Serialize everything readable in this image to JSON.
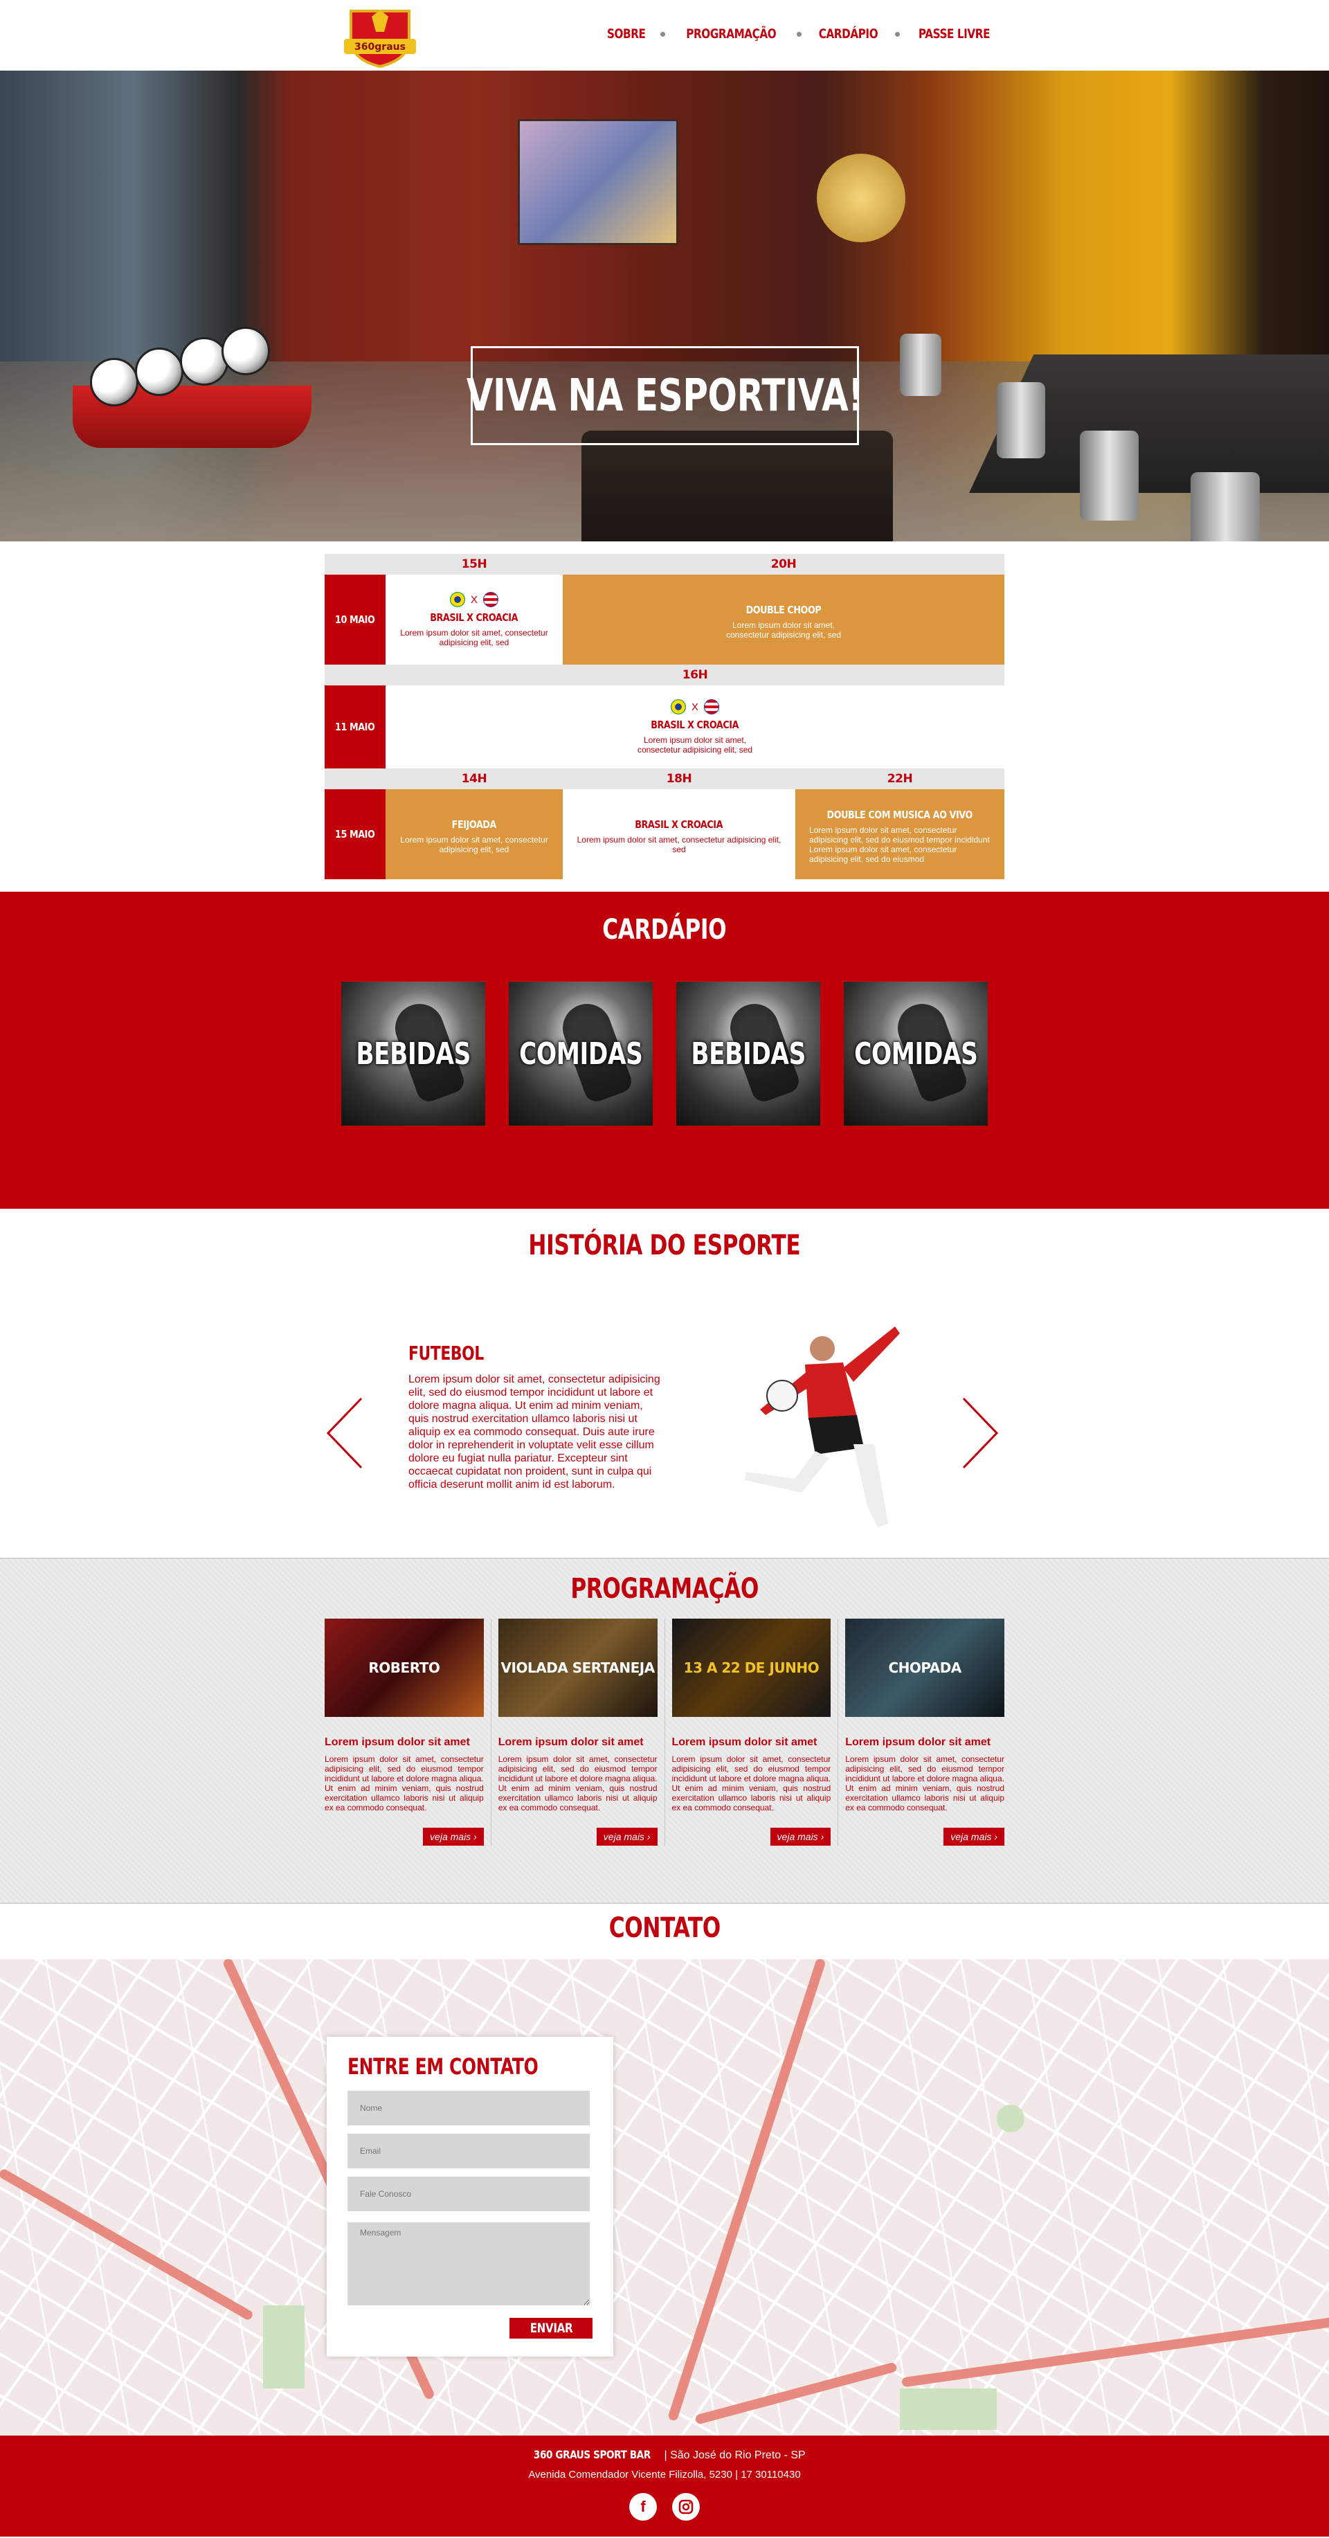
{
  "nav": {
    "items": [
      "SOBRE",
      "PROGRAMAÇÃO",
      "CARDÁPIO",
      "PASSE LIVRE"
    ]
  },
  "logo": {
    "text": "360graus"
  },
  "hero": {
    "title": "VIVA NA ESPORTIVA!"
  },
  "schedule": {
    "rows": [
      {
        "times": [
          "15H",
          "20H"
        ],
        "day": "10 MAIO",
        "cells": [
          {
            "title": "BRASIL X CROACIA",
            "text": "Lorem ipsum dolor sit amet, consectetur adipisicing elit, sed",
            "vs": "X"
          },
          {
            "title": "DOUBLE CHOOP",
            "text": "Lorem ipsum dolor sit amet, consectetur adipisicing elit, sed"
          }
        ]
      },
      {
        "times": [
          "16H"
        ],
        "day": "11 MAIO",
        "cells": [
          {
            "title": "BRASIL X CROACIA",
            "text": "Lorem ipsum dolor sit amet, consectetur adipisicing elit, sed",
            "vs": "X"
          }
        ]
      },
      {
        "times": [
          "14H",
          "18H",
          "22H"
        ],
        "day": "15 MAIO",
        "cells": [
          {
            "title": "FEIJOADA",
            "text": "Lorem ipsum dolor sit amet, consectetur adipisicing elit, sed"
          },
          {
            "title": "BRASIL X CROACIA",
            "text": "Lorem ipsum dolor sit amet, consectetur adipisicing elit, sed"
          },
          {
            "title": "DOUBLE COM MUSICA AO VIVO",
            "text": "Lorem ipsum dolor sit amet, consectetur adipisicing elit, sed do eiusmod tempor incididunt Lorem ipsum dolor sit amet, consectetur adipisicing elit, sed do eiusmod"
          }
        ]
      }
    ]
  },
  "cardapio": {
    "title": "CARDÁPIO",
    "items": [
      "BEBIDAS",
      "COMIDAS",
      "BEBIDAS",
      "COMIDAS"
    ]
  },
  "historia": {
    "title": "HISTÓRIA DO ESPORTE",
    "subtitle": "FUTEBOL",
    "text": "Lorem ipsum dolor sit amet, consectetur adipisicing elit, sed do eiusmod tempor incididunt ut labore et dolore magna aliqua. Ut enim ad minim veniam, quis nostrud exercitation ullamco laboris nisi ut aliquip ex ea commodo consequat. Duis aute irure dolor in reprehenderit in voluptate velit esse cillum dolore eu fugiat nulla pariatur. Excepteur sint occaecat cupidatat non proident, sunt in culpa qui officia deserunt mollit anim id est laborum."
  },
  "programacao": {
    "title": "PROGRAMAÇÃO",
    "button": "veja mais",
    "cards": [
      {
        "poster": "ROBERTO",
        "heading": "Lorem ipsum dolor sit amet",
        "text": "Lorem ipsum dolor sit amet, consectetur adipisicing elit, sed do eiusmod tempor incididunt ut labore et dolore magna aliqua. Ut enim ad minim veniam, quis nostrud exercitation ullamco laboris nisi ut aliquip ex ea commodo consequat.",
        "bg": "#7a1212"
      },
      {
        "poster": "VIOLADA SERTANEJA",
        "heading": "Lorem ipsum dolor sit amet",
        "text": "Lorem ipsum dolor sit amet, consectetur adipisicing elit, sed do eiusmod tempor incididunt ut labore et dolore magna aliqua. Ut enim ad minim veniam, quis nostrud exercitation ullamco laboris nisi ut aliquip ex ea commodo consequat.",
        "bg": "#3b2a16"
      },
      {
        "poster": "13 A 22 DE JUNHO",
        "heading": "Lorem ipsum dolor sit amet",
        "text": "Lorem ipsum dolor sit amet, consectetur adipisicing elit, sed do eiusmod tempor incididunt ut labore et dolore magna aliqua. Ut enim ad minim veniam, quis nostrud exercitation ullamco laboris nisi ut aliquip ex ea commodo consequat.",
        "bg": "#16161a"
      },
      {
        "poster": "CHOPADA",
        "heading": "Lorem ipsum dolor sit amet",
        "text": "Lorem ipsum dolor sit amet, consectetur adipisicing elit, sed do eiusmod tempor incididunt ut labore et dolore magna aliqua. Ut enim ad minim veniam, quis nostrud exercitation ullamco laboris nisi ut aliquip ex ea commodo consequat.",
        "bg": "#1f2a33"
      }
    ]
  },
  "contato": {
    "title": "CONTATO",
    "form_title": "ENTRE EM CONTATO",
    "fields": {
      "name": "Nome",
      "email": "Email",
      "subject": "Fale Conosco",
      "message": "Mensagem"
    },
    "submit": "ENVIAR"
  },
  "footer": {
    "brand": "360 GRAUS SPORT BAR",
    "city": "São José do Rio Preto - SP",
    "address": "Avenida Comendador Vicente Filizolla, 5230 | 17 30110430"
  },
  "colors": {
    "red": "#bf0009",
    "orange": "#dc963e",
    "gray": "#e6e6e6"
  }
}
